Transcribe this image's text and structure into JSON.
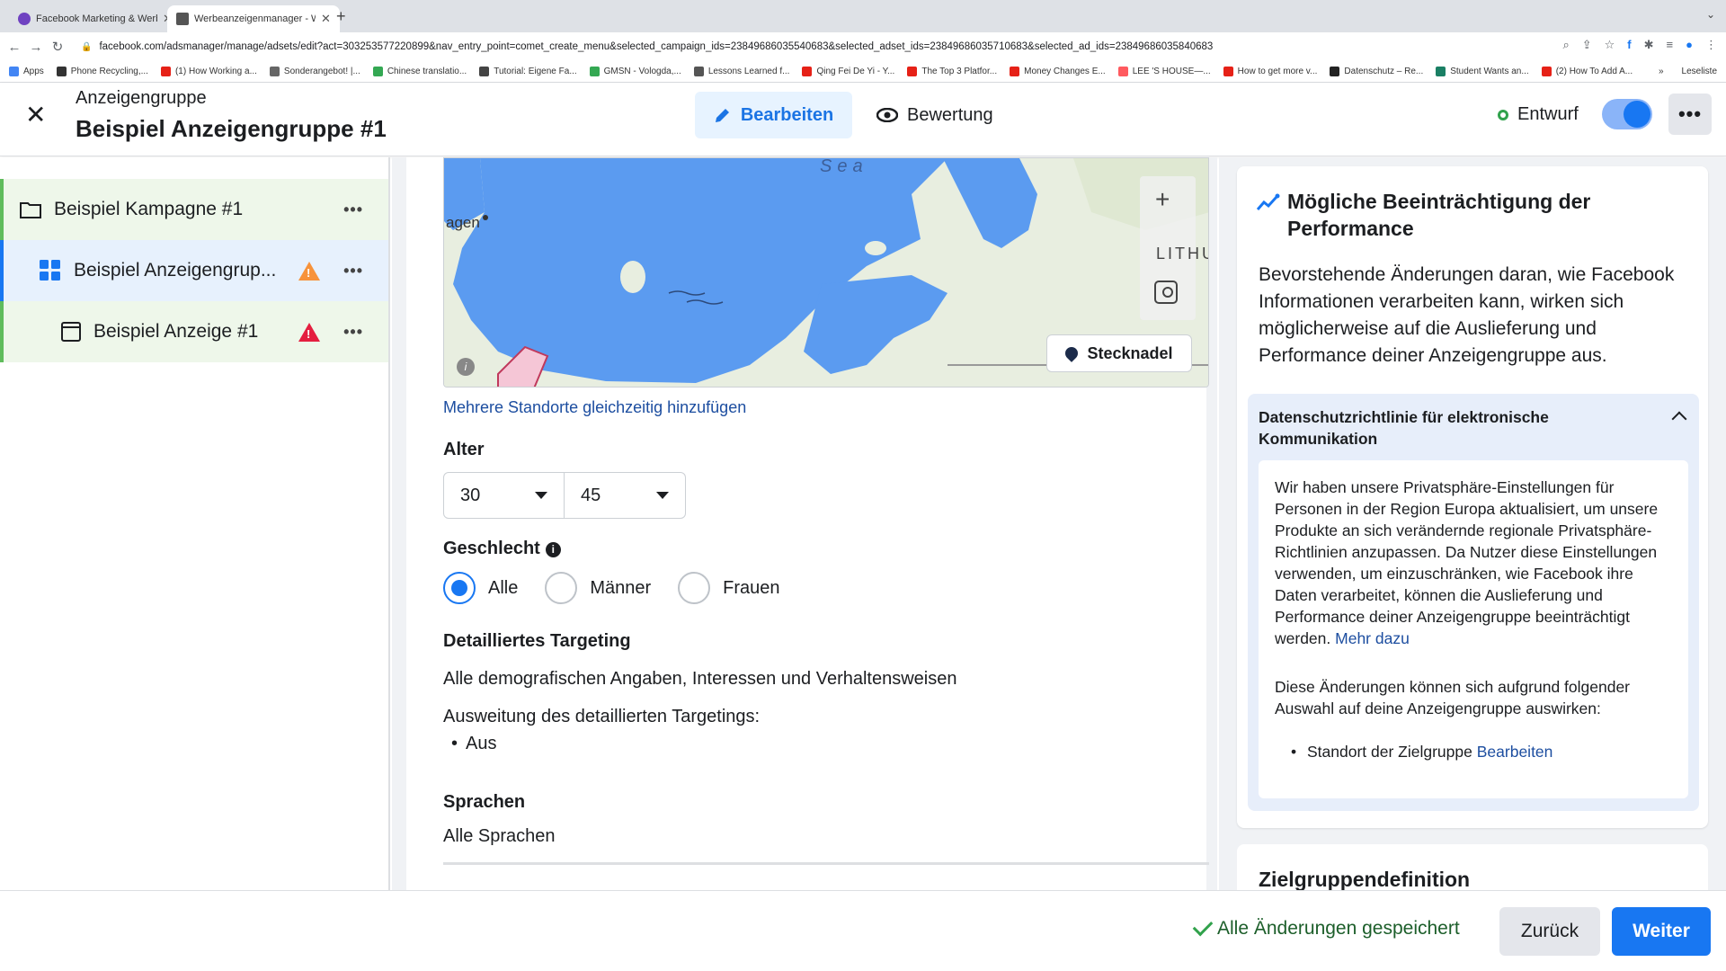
{
  "browser": {
    "tabs": [
      {
        "label": "Facebook Marketing & Werbe...",
        "color": "#6f42c1"
      },
      {
        "label": "Werbeanzeigenmanager - We...",
        "color": "#555555"
      }
    ],
    "url": "facebook.com/adsmanager/manage/adsets/edit?act=303253577220899&nav_entry_point=comet_create_menu&selected_campaign_ids=23849686035540683&selected_adset_ids=23849686035710683&selected_ad_ids=23849686035840683",
    "bookmarks": [
      {
        "label": "Apps",
        "color": "#4285f4"
      },
      {
        "label": "Phone Recycling,...",
        "color": "#333333"
      },
      {
        "label": "(1) How Working a...",
        "color": "#e62117"
      },
      {
        "label": "Sonderangebot! |...",
        "color": "#666666"
      },
      {
        "label": "Chinese translatio...",
        "color": "#34a853"
      },
      {
        "label": "Tutorial: Eigene Fa...",
        "color": "#444444"
      },
      {
        "label": "GMSN - Vologda,...",
        "color": "#34a853"
      },
      {
        "label": "Lessons Learned f...",
        "color": "#555555"
      },
      {
        "label": "Qing Fei De Yi - Y...",
        "color": "#e62117"
      },
      {
        "label": "The Top 3 Platfor...",
        "color": "#e62117"
      },
      {
        "label": "Money Changes E...",
        "color": "#e62117"
      },
      {
        "label": "LEE 'S HOUSE—...",
        "color": "#ff5a5f"
      },
      {
        "label": "How to get more v...",
        "color": "#e62117"
      },
      {
        "label": "Datenschutz – Re...",
        "color": "#222222"
      },
      {
        "label": "Student Wants an...",
        "color": "#1a7f64"
      },
      {
        "label": "(2) How To Add A...",
        "color": "#e62117"
      }
    ],
    "bookmarks_more": "»",
    "reading_list": "Leseliste"
  },
  "header": {
    "kicker": "Anzeigengruppe",
    "title": "Beispiel Anzeigengruppe #1",
    "edit_label": "Bearbeiten",
    "review_label": "Bewertung",
    "status_label": "Entwurf",
    "toggle_on": true
  },
  "tree": {
    "campaign": "Beispiel Kampagne #1",
    "adset": "Beispiel Anzeigengrup...",
    "ad": "Beispiel Anzeige #1"
  },
  "map": {
    "sea_label": "Sea",
    "city_label": "agen",
    "country_label": "LITHU",
    "pin_label": "Stecknadel",
    "info_label": "i"
  },
  "form": {
    "multi_location_link": "Mehrere Standorte gleichzeitig hinzufügen",
    "age_label": "Alter",
    "age_from": "30",
    "age_to": "45",
    "gender_label": "Geschlecht",
    "gender_options": [
      "Alle",
      "Männer",
      "Frauen"
    ],
    "gender_selected": "Alle",
    "detailed_targeting_label": "Detailliertes Targeting",
    "detailed_targeting_value": "Alle demografischen Angaben, Interessen und Verhaltensweisen",
    "expansion_label": "Ausweitung des detaillierten Targetings:",
    "expansion_value": "Aus",
    "languages_label": "Sprachen",
    "languages_value": "Alle Sprachen"
  },
  "panel": {
    "title": "Mögliche Beeinträchtigung der Performance",
    "body": "Bevorstehende Änderungen daran, wie Facebook Informationen verarbeiten kann, wirken sich möglicherweise auf die Auslieferung und Performance deiner Anzeigengruppe aus.",
    "accordion_title": "Datenschutzrichtlinie für elektronische Kommunikation",
    "accordion_p1": "Wir haben unsere Privatsphäre-Einstellungen für Personen in der Region Europa aktualisiert, um unsere Produkte an sich verändernde regionale Privatsphäre-Richtlinien anzupassen. Da Nutzer diese Einstellungen verwenden, um einzuschränken, wie Facebook ihre Daten verarbeitet, können die Auslieferung und Performance deiner Anzeigengruppe beeinträchtigt werden.",
    "more_link": "Mehr dazu",
    "accordion_p2": "Diese Änderungen können sich aufgrund folgender Auswahl auf deine Anzeigengruppe auswirken:",
    "list_item": "Standort der Zielgruppe",
    "list_item_link": "Bearbeiten",
    "next_section_title": "Zielgruppendefinition"
  },
  "footer": {
    "saved_label": "Alle Änderungen gespeichert",
    "back_label": "Zurück",
    "next_label": "Weiter"
  },
  "colors": {
    "accent": "#1877f2",
    "link": "#1d4ea0",
    "success": "#31a24c",
    "warning": "#f7923a",
    "error": "#e41e3f"
  }
}
